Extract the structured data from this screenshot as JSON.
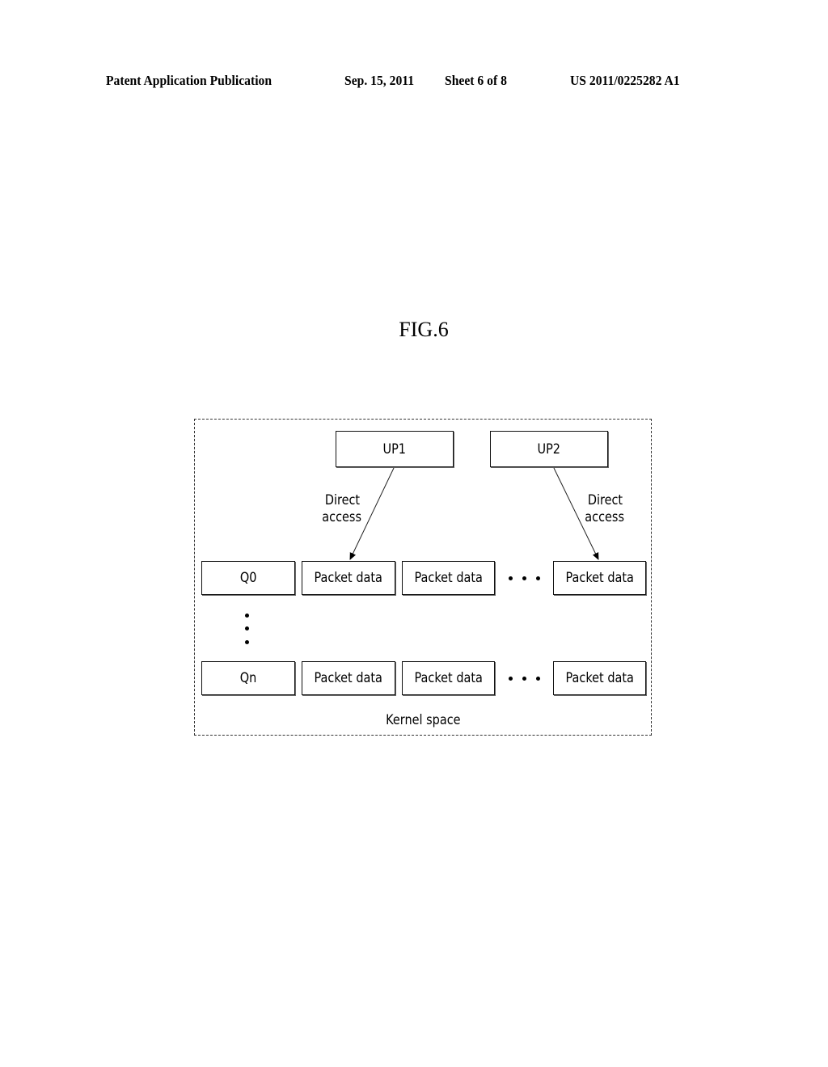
{
  "header": {
    "publication": "Patent Application Publication",
    "date": "Sep. 15, 2011",
    "sheet": "Sheet 6 of 8",
    "number": "US 2011/0225282 A1"
  },
  "figure": {
    "title": "FIG.6",
    "container_label": "Kernel space",
    "processes": [
      {
        "label": "UP1",
        "arrow_label": [
          "Direct",
          "access"
        ]
      },
      {
        "label": "UP2",
        "arrow_label": [
          "Direct",
          "access"
        ]
      }
    ],
    "queues": [
      {
        "label": "Q0",
        "cells": [
          "Packet data",
          "Packet data",
          "Packet data"
        ]
      },
      {
        "label": "Qn",
        "cells": [
          "Packet data",
          "Packet data",
          "Packet data"
        ]
      }
    ],
    "ellipsis": "• • •"
  }
}
